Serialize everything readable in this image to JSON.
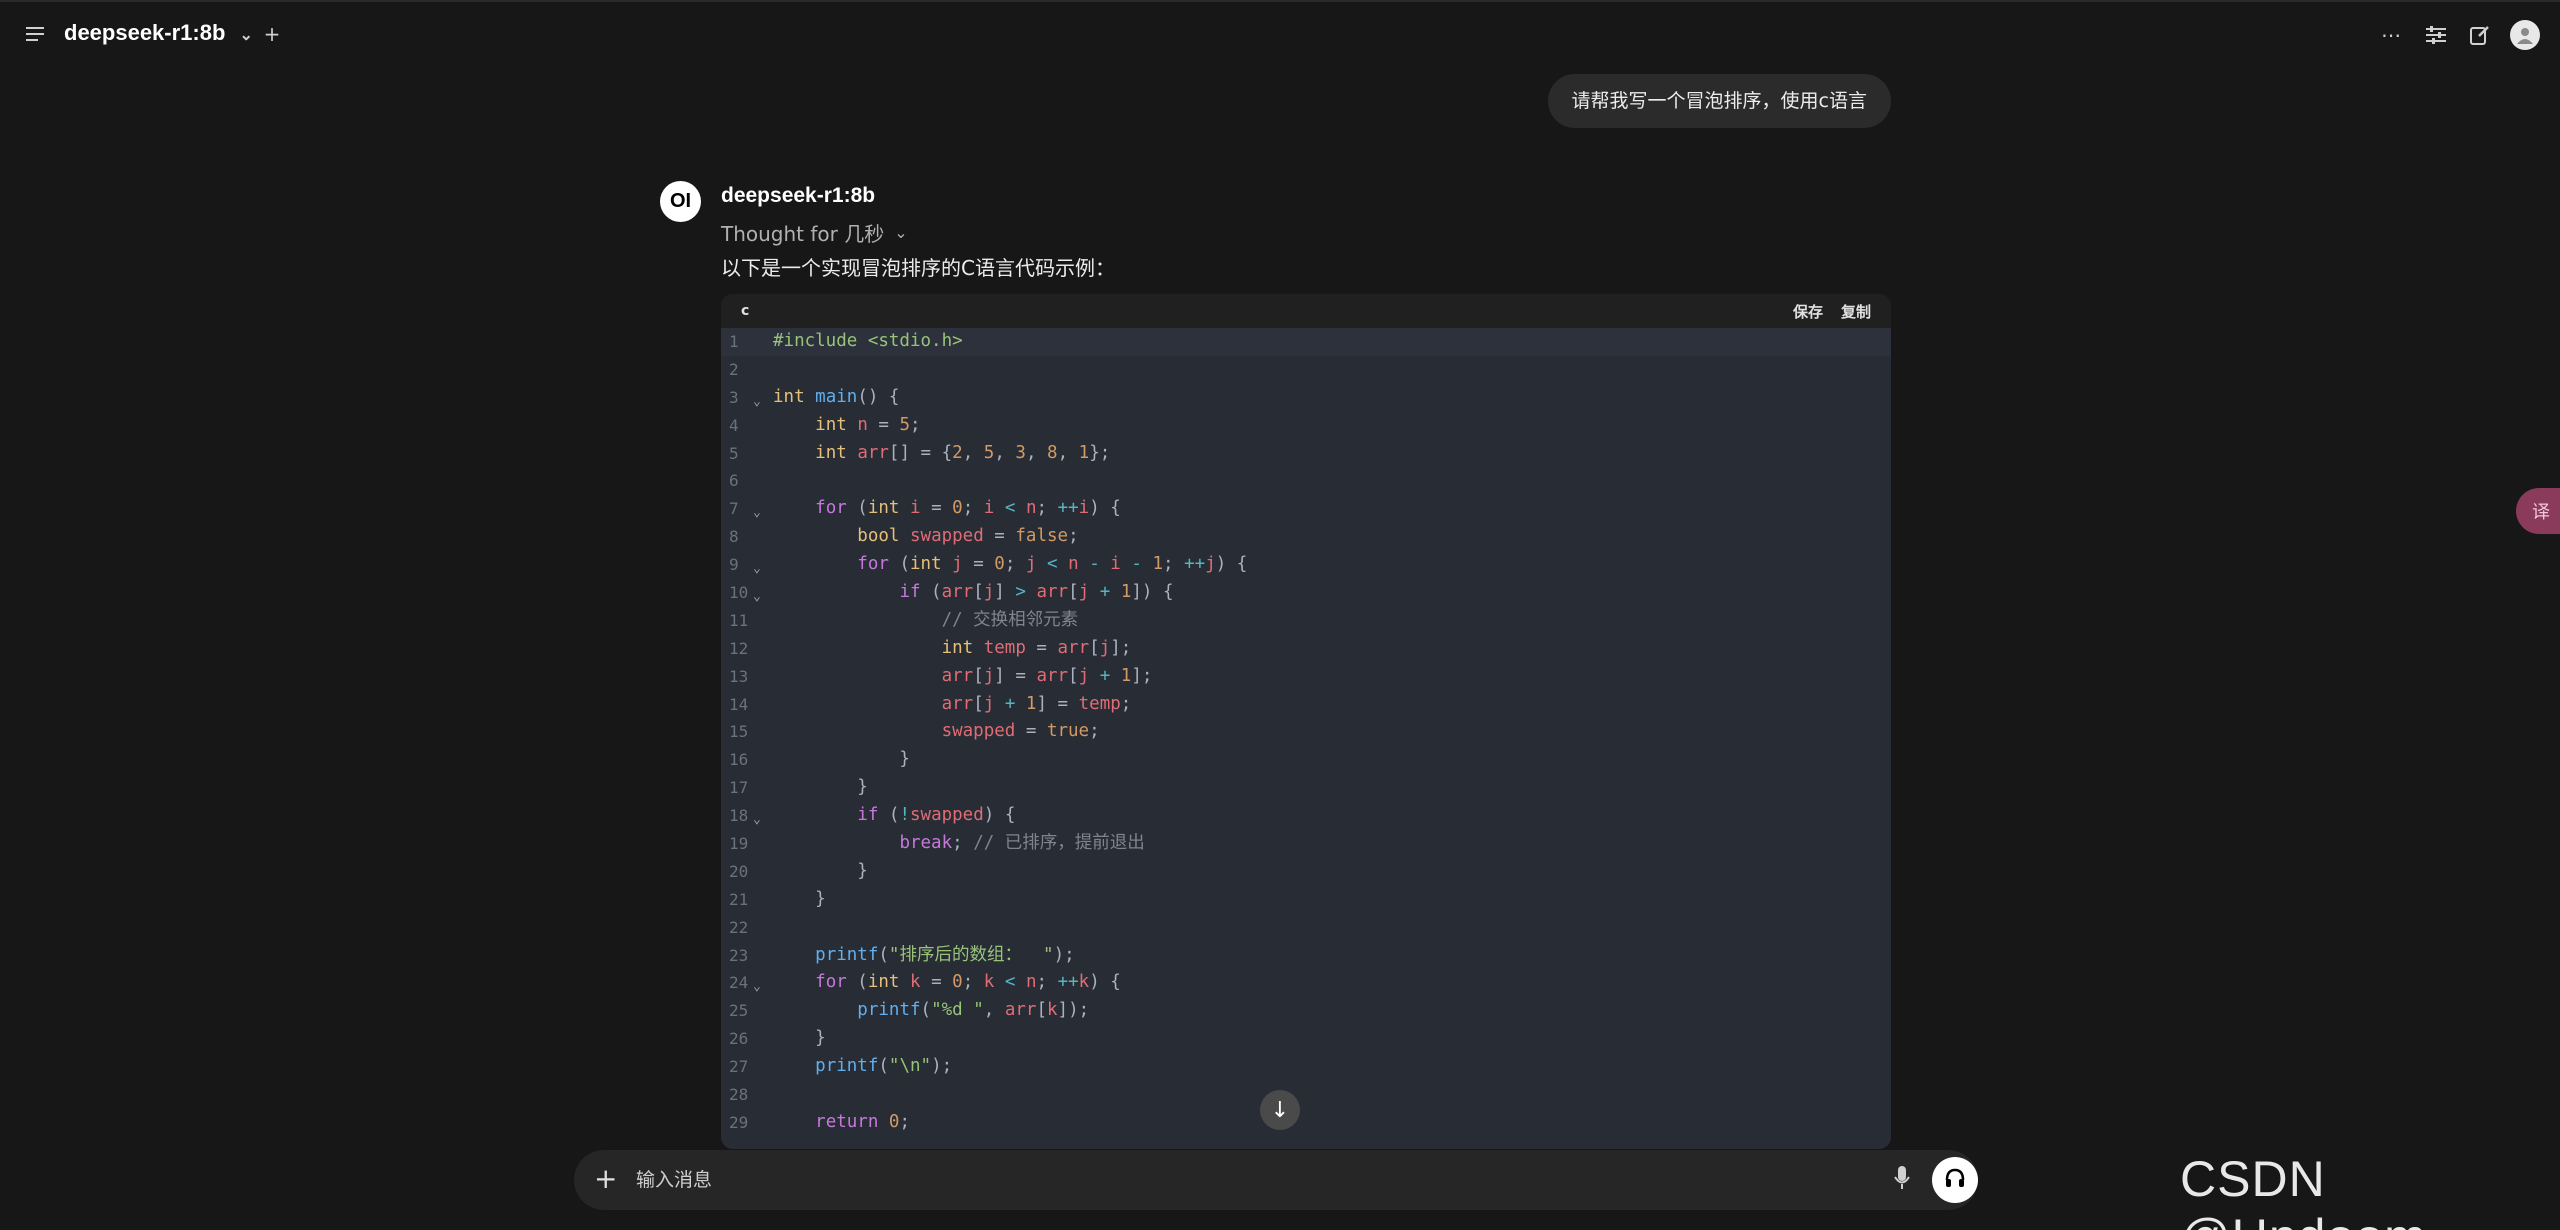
{
  "header": {
    "model_name": "deepseek-r1:8b",
    "menu_icon": "menu-icon",
    "new_tab_icon": "plus-icon",
    "right_icons": [
      "more-icon",
      "controls-icon",
      "edit-icon",
      "profile-avatar"
    ]
  },
  "chat": {
    "user_message": "请帮我写一个冒泡排序，使用c语言",
    "assistant_avatar": "OI",
    "assistant_name": "deepseek-r1:8b",
    "thought_label": "Thought for 几秒",
    "intro_text": "以下是一个实现冒泡排序的C语言代码示例：",
    "code_block": {
      "language": "c",
      "save_label": "保存",
      "copy_label": "复制",
      "line_numbers": [
        "1",
        "2",
        "3",
        "4",
        "5",
        "6",
        "7",
        "8",
        "9",
        "10",
        "11",
        "12",
        "13",
        "14",
        "15",
        "16",
        "17",
        "18",
        "19",
        "20",
        "21",
        "22",
        "23",
        "24",
        "25",
        "26",
        "27",
        "28",
        "29"
      ],
      "line_1": "#include <stdio.h>",
      "line_3_a": "int",
      "line_3_b": "main",
      "line_3_c": "() {",
      "line_4": "int",
      "line_4_v": "n",
      "line_4_n": "5",
      "line_5": "int",
      "line_5_v": "arr",
      "line_5_vals": "{2, 5, 3, 8, 1}",
      "comment_11": "// 交换相邻元素",
      "comment_19": "// 已排序，提前退出",
      "printf_23": "\"排序后的数组：  \"",
      "printf_25": "\"%d \"",
      "printf_27": "\"\\n\""
    }
  },
  "composer": {
    "placeholder": "输入消息",
    "plus_icon": "plus-icon",
    "mic_icon": "mic-icon",
    "voice_icon": "headphones-icon"
  },
  "watermark": "CSDN @Undoom",
  "side_tab_label": "译"
}
